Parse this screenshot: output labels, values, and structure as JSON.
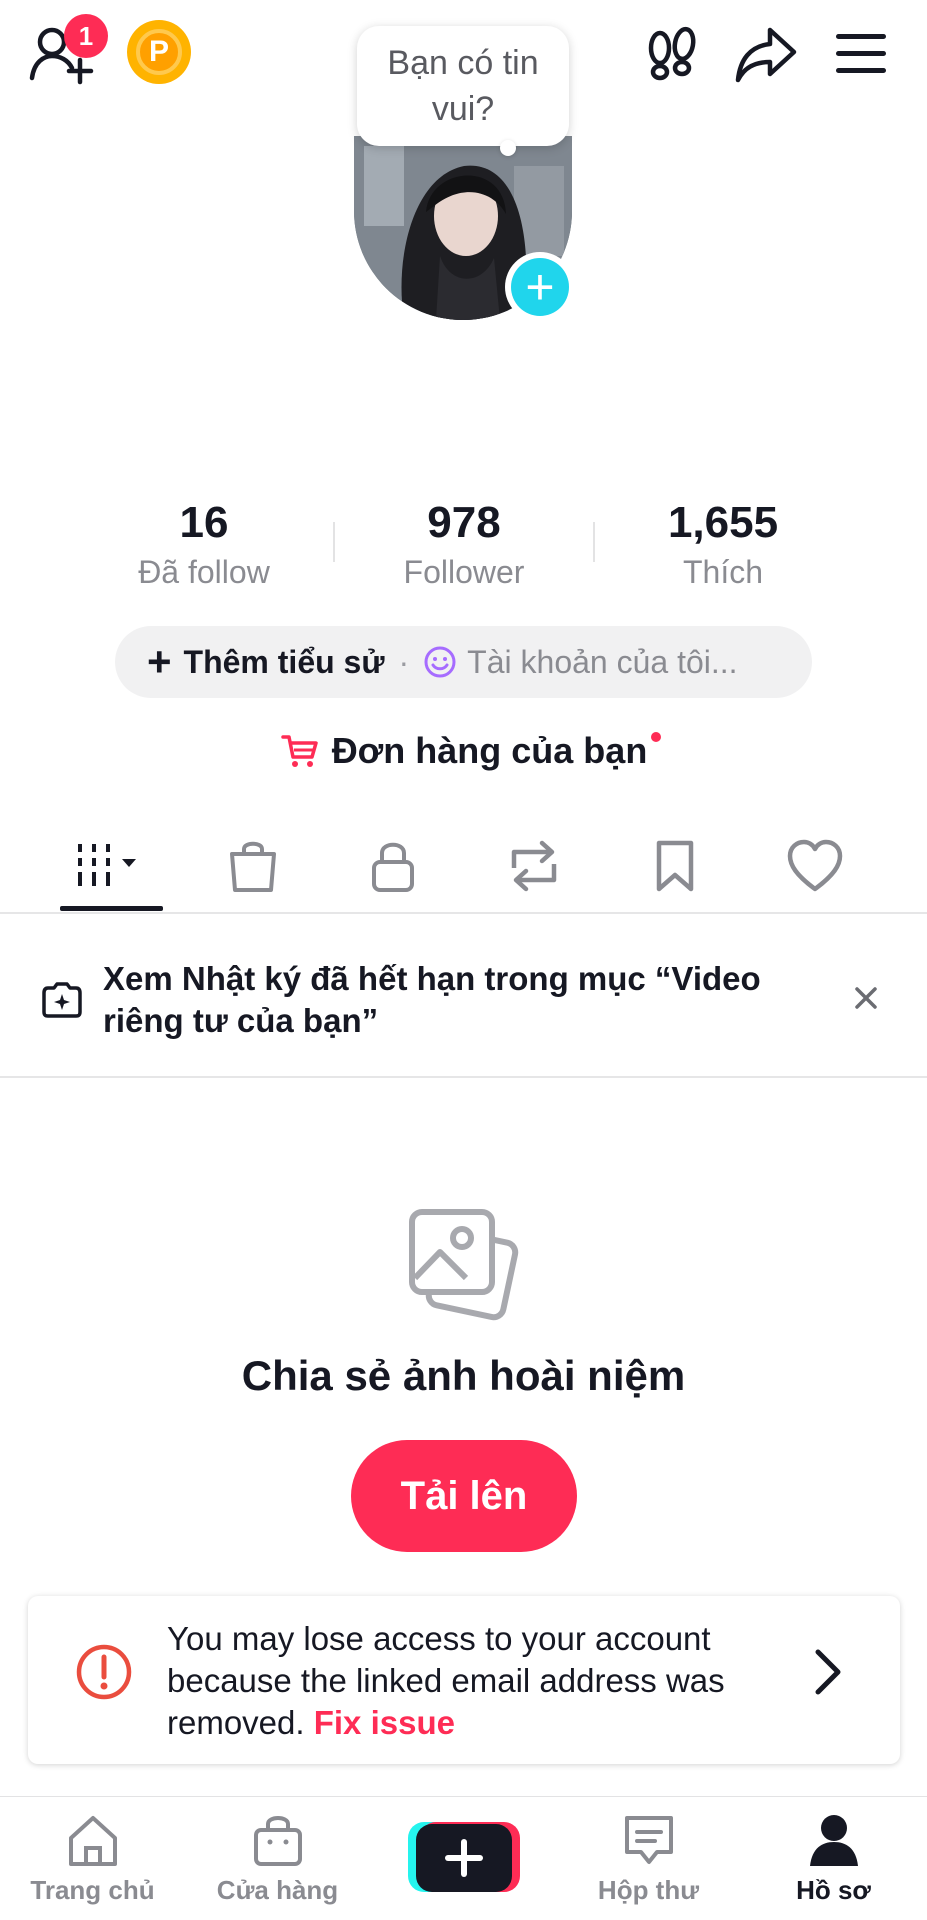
{
  "header": {
    "friend_request_count": "1",
    "coin_letter": "P"
  },
  "profile": {
    "bubble_text": "Bạn có tin vui?",
    "stats": [
      {
        "value": "16",
        "label": "Đã follow"
      },
      {
        "value": "978",
        "label": "Follower"
      },
      {
        "value": "1,655",
        "label": "Thích"
      }
    ],
    "add_bio_label": "Thêm tiểu sử",
    "separator": "·",
    "account_label": "Tài khoản của tôi...",
    "orders_label": "Đơn hàng của bạn"
  },
  "tabs": [
    {
      "name": "videos",
      "icon": "grid-icon",
      "active": true
    },
    {
      "name": "shop",
      "icon": "shopping-bag-icon"
    },
    {
      "name": "private",
      "icon": "lock-icon"
    },
    {
      "name": "reposts",
      "icon": "repost-icon"
    },
    {
      "name": "saved",
      "icon": "bookmark-icon"
    },
    {
      "name": "liked",
      "icon": "heart-icon"
    }
  ],
  "notice": {
    "text": "Xem Nhật ký đã hết hạn trong mục “Video riêng tư của bạn”"
  },
  "empty_state": {
    "title": "Chia sẻ ảnh hoài niệm",
    "upload_label": "Tải lên"
  },
  "warning": {
    "text": "You may lose access to your account because the linked email address was removed. ",
    "link": "Fix issue"
  },
  "bottom_nav": {
    "items": [
      {
        "label": "Trang chủ",
        "icon": "home-icon"
      },
      {
        "label": "Cửa hàng",
        "icon": "shop-icon"
      },
      {
        "label": "Hộp thư",
        "icon": "inbox-icon"
      },
      {
        "label": "Hồ sơ",
        "icon": "profile-icon",
        "active": true
      }
    ]
  },
  "colors": {
    "accent": "#fe2c55",
    "cyan": "#20d5ec",
    "text": "#161823",
    "secondary": "#8a8b91"
  }
}
